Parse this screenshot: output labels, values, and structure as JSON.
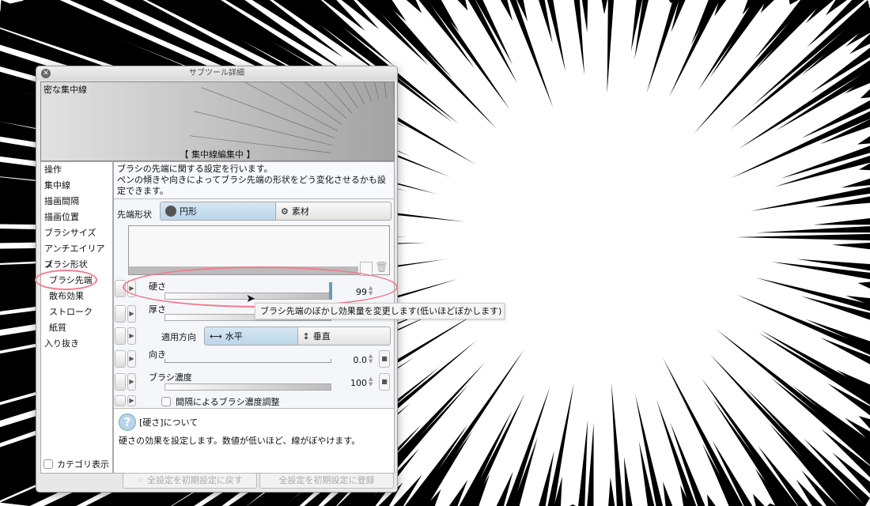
{
  "window": {
    "title": "サブツール詳細",
    "close_icon": "close-icon"
  },
  "preview": {
    "name": "密な集中線",
    "caption": "【 集中線編集中 】"
  },
  "sidebar": {
    "items": [
      "操作",
      "集中線",
      "描画間隔",
      "描画位置",
      "ブラシサイズ",
      "アンチエイリアス",
      "ブラシ形状",
      "ブラシ先端",
      "散布効果",
      "ストローク",
      "紙質",
      "入り抜き"
    ],
    "selected": "ブラシ先端",
    "category_label": "カテゴリ表示"
  },
  "main": {
    "description": "ブラシの先端に関する設定を行います。\nペンの傾きや向きによってブラシ先端の形状をどう変化させるかも設定できます。",
    "tip_shape": {
      "label": "先端形状",
      "options": [
        "円形",
        "素材"
      ],
      "selected": "円形"
    },
    "hardness": {
      "label": "硬さ",
      "value": "99",
      "fraction": 0.99
    },
    "thickness": {
      "label": "厚さ"
    },
    "direction_apply": {
      "label": "適用方向",
      "options": [
        "水平",
        "垂直"
      ],
      "selected": "水平"
    },
    "angle": {
      "label": "向き",
      "value": "0.0"
    },
    "density": {
      "label": "ブラシ濃度",
      "value": "100",
      "fraction": 1.0
    },
    "interval_density": {
      "label": "間隔によるブラシ濃度調整",
      "checked": false
    }
  },
  "help": {
    "title": "[硬さ]について",
    "text": "硬さの効果を設定します。数値が低いほど、線がぼやけます。"
  },
  "footer": {
    "reset": "全設定を初期設定に戻す",
    "register": "全設定を初期設定に登録"
  },
  "tooltip": "ブラシ先端のぼかし効果量を変更します(低いほどぼかします)",
  "colors": {
    "highlight": "#ef7d8e",
    "selected_seg": "#c6ddef"
  }
}
